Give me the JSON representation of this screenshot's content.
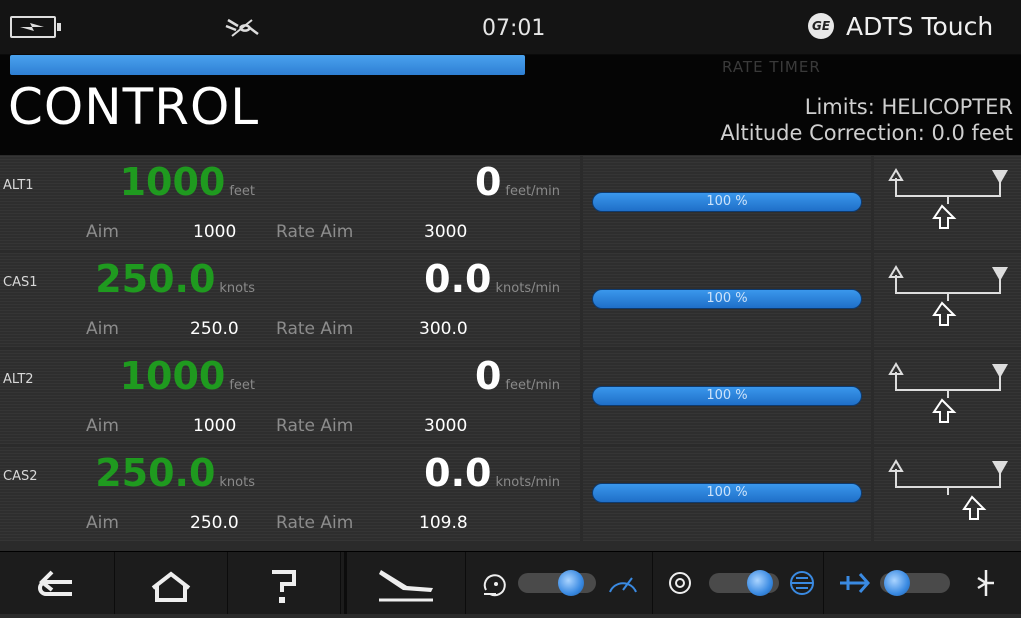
{
  "status": {
    "time": "07:01",
    "brand_logo": "GE",
    "app_title": "ADTS Touch"
  },
  "header": {
    "progress_percent": 100,
    "rate_timer": "RATE TIMER",
    "title": "CONTROL",
    "limits": "Limits: HELICOPTER",
    "altitude_correction": "Altitude Correction: 0.0 feet"
  },
  "rows": [
    {
      "channel": "ALT1",
      "value": "1000",
      "value_unit": "feet",
      "rate": "0",
      "rate_unit": "feet/min",
      "aim_label": "Aim",
      "aim": "1000",
      "rate_aim_label": "Rate Aim",
      "rate_aim": "3000",
      "percent": "100 %"
    },
    {
      "channel": "CAS1",
      "value": "250.0",
      "value_unit": "knots",
      "rate": "0.0",
      "rate_unit": "knots/min",
      "aim_label": "Aim",
      "aim": "250.0",
      "rate_aim_label": "Rate Aim",
      "rate_aim": "300.0",
      "percent": "100 %"
    },
    {
      "channel": "ALT2",
      "value": "1000",
      "value_unit": "feet",
      "rate": "0",
      "rate_unit": "feet/min",
      "aim_label": "Aim",
      "aim": "1000",
      "rate_aim_label": "Rate Aim",
      "rate_aim": "3000",
      "percent": "100 %"
    },
    {
      "channel": "CAS2",
      "value": "250.0",
      "value_unit": "knots",
      "rate": "0.0",
      "rate_unit": "knots/min",
      "aim_label": "Aim",
      "aim": "250.0",
      "rate_aim_label": "Rate Aim",
      "rate_aim": "109.8",
      "percent": "100 %"
    }
  ],
  "icons": {
    "status": [
      "battery-icon",
      "plug-icon"
    ],
    "nav": [
      "back-arrow-icon",
      "home-icon",
      "help-icon",
      "landing-icon",
      "gauge-mode-icon",
      "speed-gauge-icon",
      "altimeter-icon",
      "attitude-icon",
      "aircraft-icon",
      "vent-icon"
    ]
  },
  "colors": {
    "value_green": "#1f9a1f",
    "accent_blue": "#2e7fd4",
    "background": "#2b2b2b"
  }
}
